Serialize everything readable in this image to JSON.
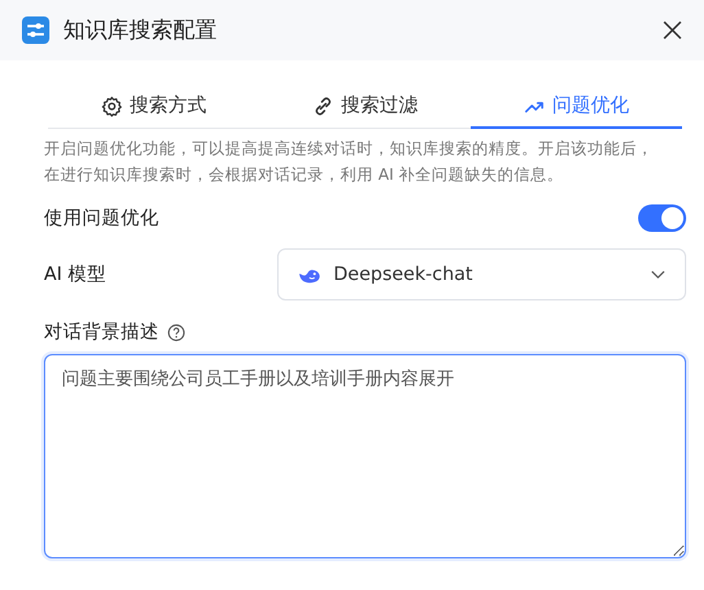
{
  "window": {
    "title": "知识库搜索配置"
  },
  "tabs": [
    {
      "label": "搜索方式",
      "selected": false
    },
    {
      "label": "搜索过滤",
      "selected": false
    },
    {
      "label": "问题优化",
      "selected": true
    }
  ],
  "description": "开启问题优化功能，可以提高提高连续对话时，知识库搜索的精度。开启该功能后，在进行知识库搜索时，会根据对话记录，利用 AI 补全问题缺失的信息。",
  "toggle": {
    "label": "使用问题优化",
    "on": true
  },
  "model": {
    "label": "AI 模型",
    "value": "Deepseek-chat"
  },
  "background": {
    "label": "对话背景描述",
    "value": "问题主要围绕公司员工手册以及培训手册内容展开"
  }
}
